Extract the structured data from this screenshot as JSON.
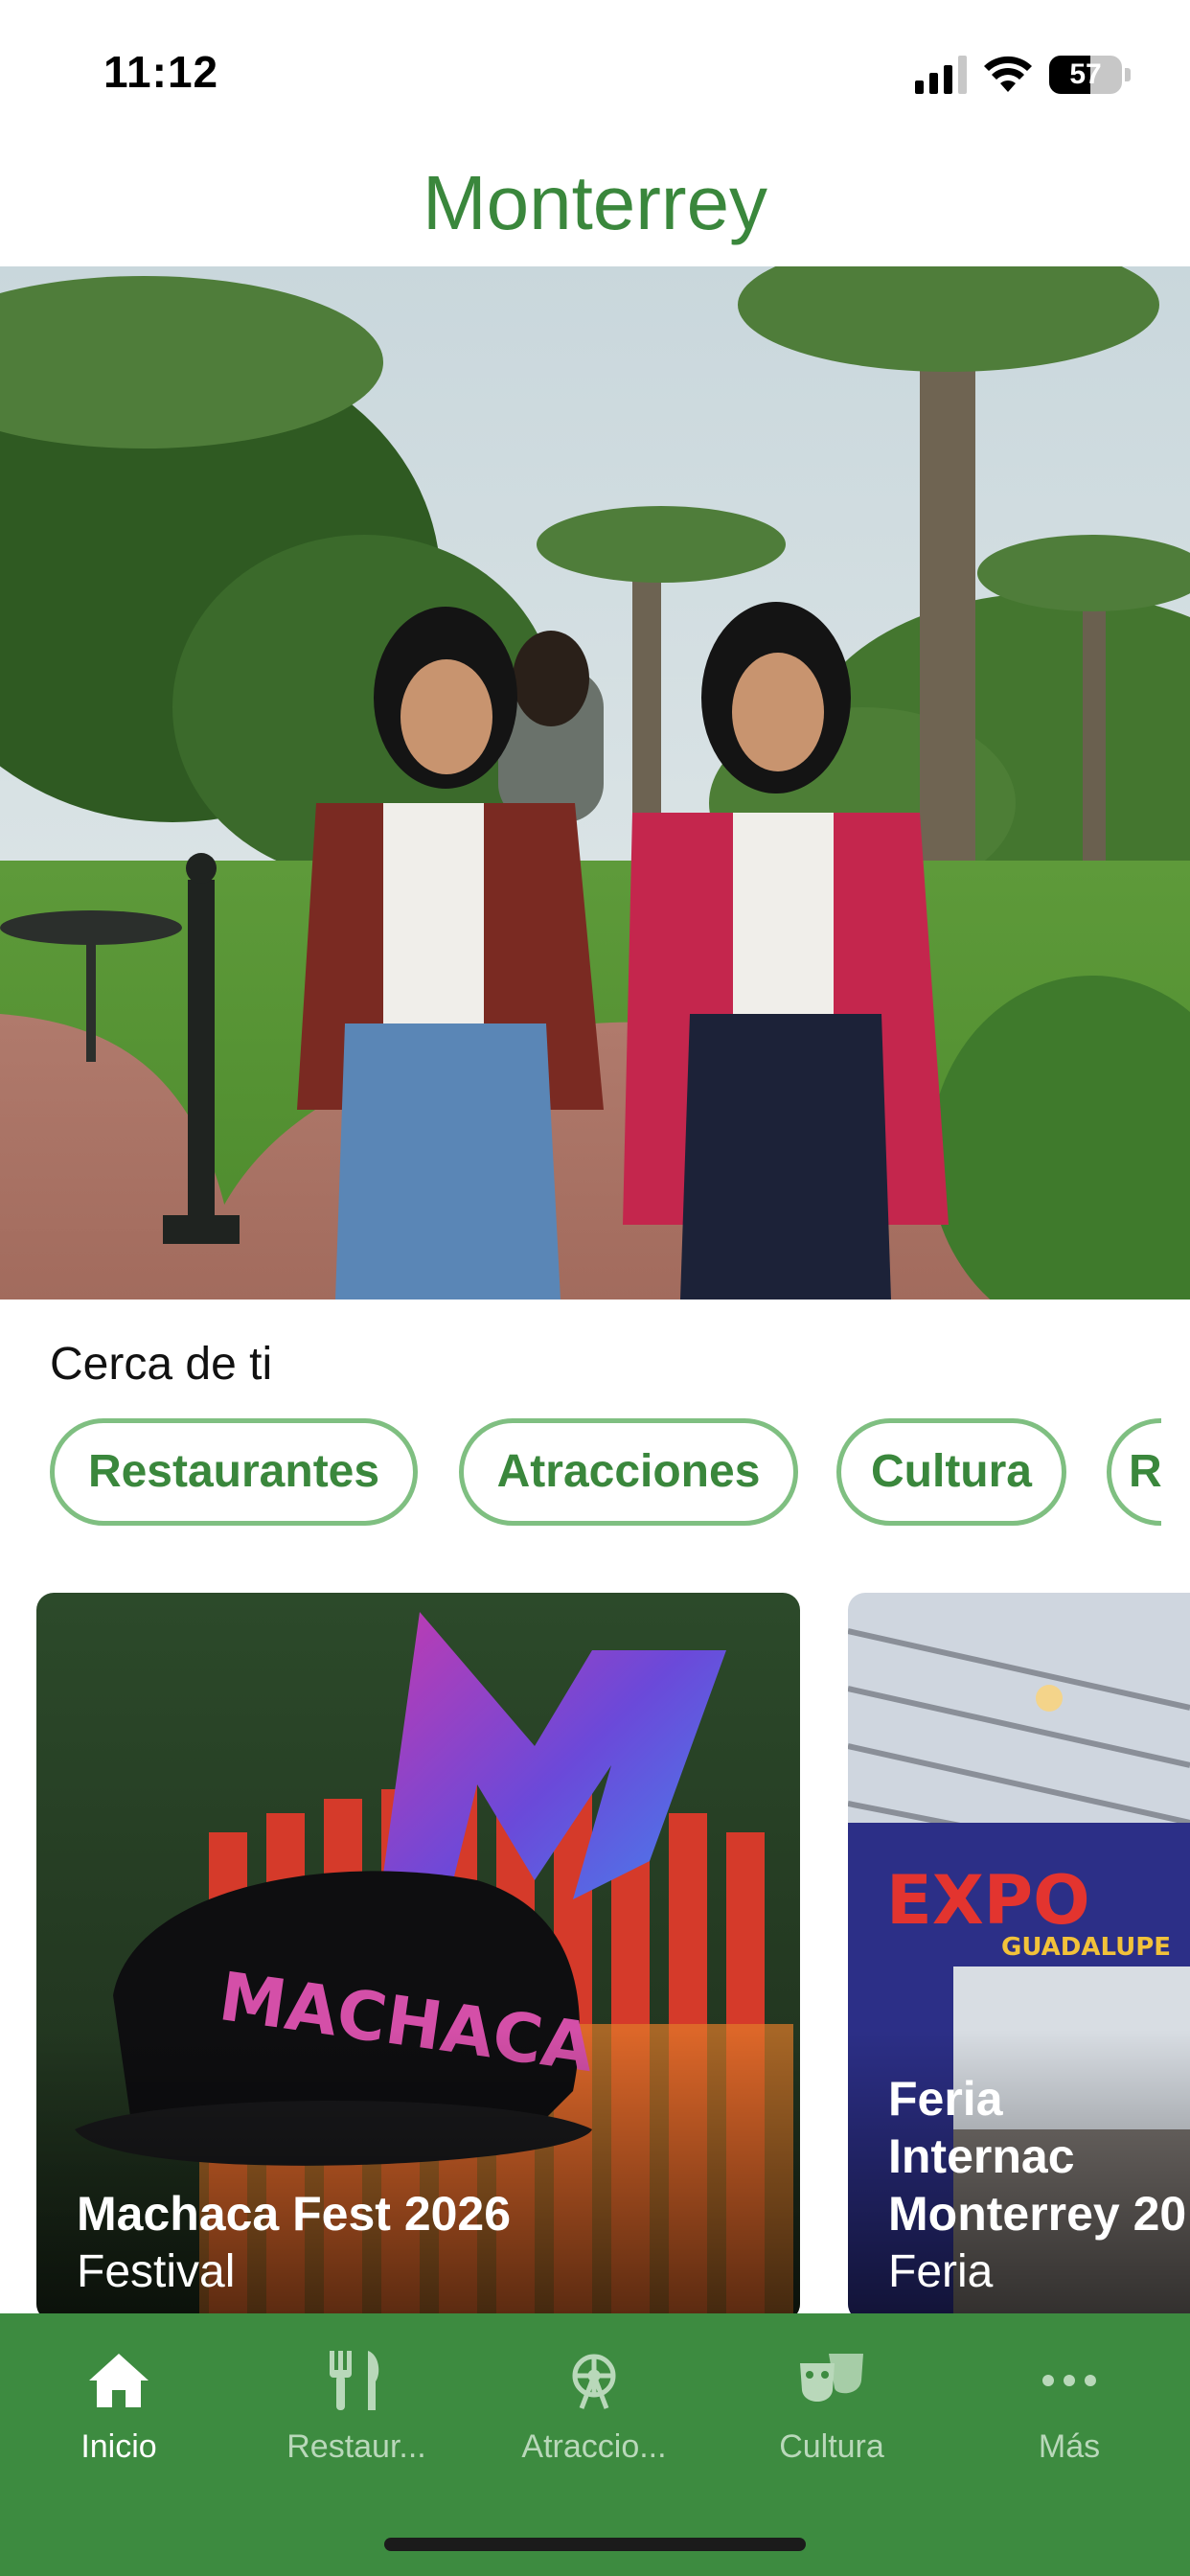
{
  "status_bar": {
    "time": "11:12",
    "battery": "57",
    "battery_level": 0.57
  },
  "header": {
    "title": "Monterrey"
  },
  "hero": {
    "image": "park-women-walking-photo"
  },
  "nearby": {
    "title": "Cerca de ti",
    "chips": [
      {
        "label": "Restaurantes"
      },
      {
        "label": "Atracciones"
      },
      {
        "label": "Cultura"
      },
      {
        "label": "R"
      }
    ]
  },
  "cards": [
    {
      "title": "Machaca Fest 2026",
      "subtitle": "Festival",
      "image": "machaca-cap-photo"
    },
    {
      "title": "Feria Internac\nMonterrey 20",
      "subtitle": "Feria",
      "image": "expo-guadalupe-photo"
    }
  ],
  "tabbar": {
    "tabs": [
      {
        "label": "Inicio",
        "icon": "home-icon"
      },
      {
        "label": "Restaur...",
        "icon": "fork-knife-icon"
      },
      {
        "label": "Atraccio...",
        "icon": "ferris-wheel-icon"
      },
      {
        "label": "Cultura",
        "icon": "theater-masks-icon"
      },
      {
        "label": "Más",
        "icon": "more-dots-icon"
      }
    ]
  },
  "colors": {
    "brand_green": "#3d8b40",
    "title_green": "#3a873c",
    "chip_border": "#7fbf81"
  }
}
